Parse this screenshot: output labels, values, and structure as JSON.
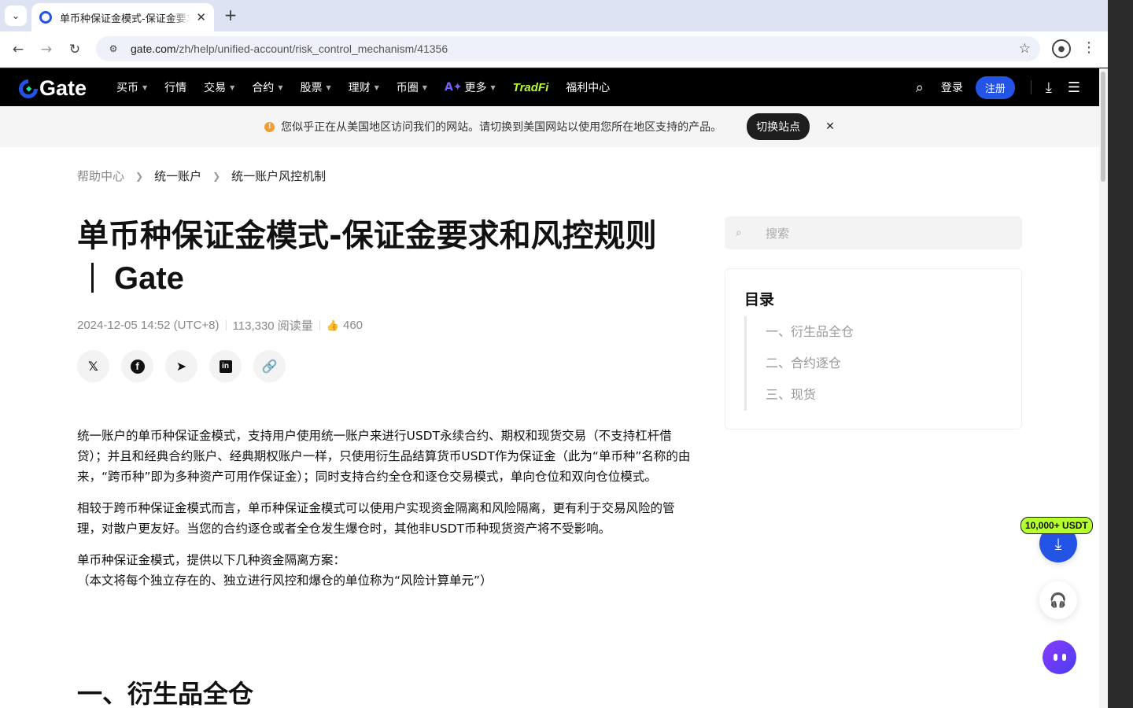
{
  "browser": {
    "tab_title": "单币种保证金模式-保证金要求和风控规则",
    "tab_close": "✕",
    "new_tab": "+",
    "url_host": "gate.com",
    "url_path": "/zh/help/unified-account/risk_control_mechanism/41356"
  },
  "nav": {
    "logo": "Gate",
    "items": [
      {
        "label": "买币",
        "caret": true
      },
      {
        "label": "行情",
        "caret": false
      },
      {
        "label": "交易",
        "caret": true
      },
      {
        "label": "合约",
        "caret": true
      },
      {
        "label": "股票",
        "caret": true
      },
      {
        "label": "理财",
        "caret": true
      },
      {
        "label": "币圈",
        "caret": true
      }
    ],
    "more_label": "更多",
    "tradfi": "TradFi",
    "welfare": "福利中心",
    "login": "登录",
    "signup": "注册"
  },
  "banner": {
    "text": "您似乎正在从美国地区访问我们的网站。请切换到美国网站以使用您所在地区支持的产品。",
    "button": "切换站点",
    "close": "✕"
  },
  "breadcrumb": [
    "帮助中心",
    "统一账户",
    "统一账户风控机制"
  ],
  "article": {
    "title_main": "单币种保证金模式-保证金要求和风控规则",
    "title_brand": "Gate",
    "date": "2024-12-05 14:52 (UTC+8)",
    "views": "113,330 阅读量",
    "likes": "460",
    "paragraphs": [
      "统一账户的单币种保证金模式，支持用户使用统一账户来进行USDT永续合约、期权和现货交易（不支持杠杆借贷）；并且和经典合约账户、经典期权账户一样，只使用衍生品结算货币USDT作为保证金（此为“单币种”名称的由来，“跨币种”即为多种资产可用作保证金）；同时支持合约全仓和逐仓交易模式，单向仓位和双向仓位模式。",
      "相较于跨币种保证金模式而言，单币种保证金模式可以使用户实现资金隔离和风险隔离，更有利于交易风险的管理，对散户更友好。当您的合约逐仓或者全仓发生爆仓时，其他非USDT币种现货资产将不受影响。"
    ],
    "para3_line1": "单币种保证金模式，提供以下几种资金隔离方案：",
    "para3_line2": "（本文将每个独立存在的、独立进行风控和爆仓的单位称为“风险计算单元”）",
    "section_heading": "一、衍生品全仓"
  },
  "sidebar": {
    "search_placeholder": "搜索",
    "toc_title": "目录",
    "toc_items": [
      "一、衍生品全仓",
      "二、合约逐仓",
      "三、现货"
    ]
  },
  "floating": {
    "bonus": "10,000+ USDT"
  }
}
